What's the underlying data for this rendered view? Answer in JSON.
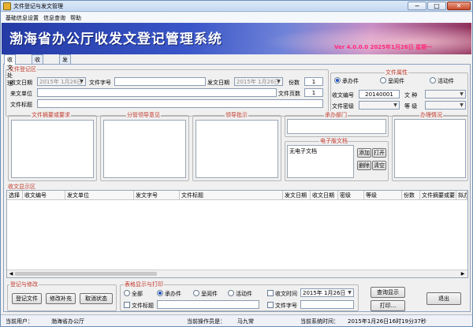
{
  "window": {
    "title": "文件登记与发文管理",
    "min": "−",
    "max": "□",
    "close": "✕"
  },
  "menu": [
    "基础信息设置",
    "信息查询",
    "帮助"
  ],
  "banner": {
    "title": "渤海省办公厅收发文登记管理系统",
    "version": "Ver 4.0.0.0 2025年1月26日 星期一"
  },
  "tabs": [
    "收文处理",
    "收文查询",
    "发文登记管理"
  ],
  "reg": {
    "group_label": "文件登记区",
    "recv_date_label": "收文日期",
    "recv_date": "2015年 1月26日",
    "doc_no_label": "文件字号",
    "doc_no": "",
    "send_date_label": "发文日期",
    "send_date": "2015年 1月26日",
    "copies_label": "份数",
    "copies": "1",
    "unit_label": "来文单位",
    "unit": "",
    "pages_label": "文件页数",
    "pages": "1",
    "title_label": "文件标题",
    "title": ""
  },
  "attr": {
    "group_label": "文件属性",
    "r1": "承办件",
    "r2": "呈阅件",
    "r3": "活动件",
    "recv_no_label": "收文编号",
    "recv_no": "20140001",
    "type_label": "文 种",
    "type": "",
    "secret_label": "文件密级",
    "secret": "",
    "level_label": "等 级",
    "level": ""
  },
  "sections": {
    "summary": "文件摘要或要求",
    "lead": "分管领导意见",
    "instr": "领导批示",
    "dept": "承办部门",
    "e_doc": "电子版文档",
    "e_doc_item": "无电子文档",
    "add": "添加",
    "open": "打开",
    "del": "删除",
    "clear": "清空",
    "progress": "办理情况"
  },
  "table": {
    "label": "收文显示区",
    "columns": [
      "选择",
      "收文编号",
      "发文单位",
      "发文字号",
      "文件标题",
      "发文日期",
      "收文日期",
      "密级",
      "等级",
      "份数",
      "文件摘要或要",
      "拟办意"
    ]
  },
  "reg_buttons": {
    "label": "登记与修改",
    "reg": "登记文件",
    "edit": "修改补充",
    "cancel": "取消状态"
  },
  "print": {
    "label": "表格显示与打印",
    "all": "全部",
    "r1": "承办件",
    "r2": "呈阅件",
    "r3": "活动件",
    "recv_time": "收文时间",
    "recv_date": "2015年 1月26日",
    "title": "文件标题",
    "doc_no": "文件字号",
    "query": "查询显示",
    "print": "打印..."
  },
  "exit": "退出",
  "status": {
    "user_label": "当前用户：",
    "user": "渤海省办公厅",
    "op_label": "当前操作员是：",
    "op": "马九常",
    "time_label": "当前系统时间：",
    "time": "2015年1月26日16时19分37秒"
  },
  "colors": {
    "accent_label": "#c0392b",
    "banner_title": "#ffffff",
    "banner_version": "#ff2a7a"
  }
}
